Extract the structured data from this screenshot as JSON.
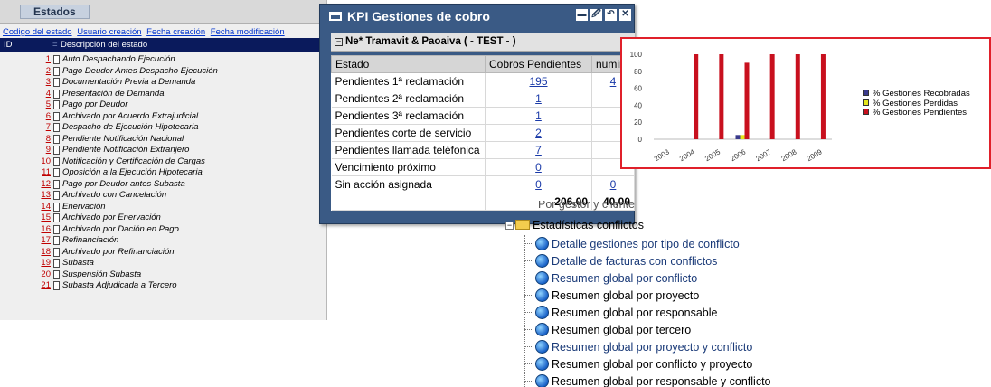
{
  "estados": {
    "title": "Estados",
    "sort_links": [
      "Codigo del estado",
      "Usuario creación",
      "Fecha creación",
      "Fecha modificación"
    ],
    "columns": {
      "id": "ID",
      "sort_marker": "=",
      "description": "Descripción del estado"
    },
    "rows": [
      {
        "id": "1",
        "desc": "Auto Despachando Ejecución"
      },
      {
        "id": "2",
        "desc": "Pago Deudor Antes Despacho Ejecución"
      },
      {
        "id": "3",
        "desc": "Documentación Previa a Demanda"
      },
      {
        "id": "4",
        "desc": "Presentación de Demanda"
      },
      {
        "id": "5",
        "desc": "Pago por Deudor"
      },
      {
        "id": "6",
        "desc": "Archivado por Acuerdo Extrajudicial"
      },
      {
        "id": "7",
        "desc": "Despacho de Ejecución Hipotecaria"
      },
      {
        "id": "8",
        "desc": "Pendiente Notificación Nacional"
      },
      {
        "id": "9",
        "desc": "Pendiente Notificación Extranjero"
      },
      {
        "id": "10",
        "desc": "Notificación y Certificación de Cargas"
      },
      {
        "id": "11",
        "desc": "Oposición a la Ejecución Hipotecaria"
      },
      {
        "id": "12",
        "desc": "Pago por Deudor antes Subasta"
      },
      {
        "id": "13",
        "desc": "Archivado con Cancelación"
      },
      {
        "id": "14",
        "desc": "Enervación"
      },
      {
        "id": "15",
        "desc": "Archivado por Enervación"
      },
      {
        "id": "16",
        "desc": "Archivado por Dación en Pago"
      },
      {
        "id": "17",
        "desc": "Refinanciación"
      },
      {
        "id": "18",
        "desc": "Archivado por Refinanciación"
      },
      {
        "id": "19",
        "desc": "Subasta"
      },
      {
        "id": "20",
        "desc": "Suspensión Subasta"
      },
      {
        "id": "21",
        "desc": "Subasta Adjudicada a Tercero"
      }
    ]
  },
  "kpi": {
    "title": "KPI Gestiones de cobro",
    "controls": [
      "▬",
      "🖉",
      "↶",
      "✕"
    ],
    "subheader_toggle": "−",
    "subheader": "Ne* Tramavit & Paoaiva ( - TEST - )",
    "columns": [
      "Estado",
      "Cobros Pendientes",
      "numin"
    ],
    "rows": [
      {
        "estado": "Pendientes 1ª reclamación",
        "cobros": "195",
        "num": "4"
      },
      {
        "estado": "Pendientes 2ª reclamación",
        "cobros": "1",
        "num": ""
      },
      {
        "estado": "Pendientes 3ª reclamación",
        "cobros": "1",
        "num": ""
      },
      {
        "estado": "Pendientes corte de servicio",
        "cobros": "2",
        "num": ""
      },
      {
        "estado": "Pendientes llamada teléfonica",
        "cobros": "7",
        "num": ""
      },
      {
        "estado": "Vencimiento próximo",
        "cobros": "0",
        "num": ""
      },
      {
        "estado": "Sin acción asignada",
        "cobros": "0",
        "num": "0"
      }
    ],
    "totals": {
      "label": "",
      "cobros": "206,00",
      "num": "40,00"
    }
  },
  "chart_data": {
    "type": "bar",
    "categories": [
      "2003",
      "2004",
      "2005",
      "2006",
      "2007",
      "2008",
      "2009"
    ],
    "ylim": [
      0,
      100
    ],
    "yticks": [
      0,
      20,
      40,
      60,
      80,
      100
    ],
    "grid": false,
    "legend_position": "right",
    "series": [
      {
        "name": "% Gestiones Recobradas",
        "color": "#3a3a8c",
        "values": [
          0,
          0,
          0,
          5,
          0,
          0,
          0
        ]
      },
      {
        "name": "% Gestiones Perdidas",
        "color": "#e6e61a",
        "values": [
          0,
          0,
          0,
          5,
          0,
          0,
          0
        ]
      },
      {
        "name": "% Gestiones Pendientes",
        "color": "#c8101e",
        "values": [
          0,
          100,
          100,
          90,
          100,
          100,
          100
        ]
      }
    ]
  },
  "tree": {
    "fragment": "Por gestor y cliente",
    "expander": "−",
    "folder": "Estadísticas conflictos",
    "items": [
      {
        "label": "Detalle gestiones por tipo de conflicto",
        "style": "link"
      },
      {
        "label": "Detalle de facturas con conflictos",
        "style": "link"
      },
      {
        "label": "Resumen global por conflicto",
        "style": "link"
      },
      {
        "label": "Resumen global por proyecto",
        "style": "plain"
      },
      {
        "label": "Resumen global por responsable",
        "style": "plain"
      },
      {
        "label": "Resumen global por tercero",
        "style": "plain"
      },
      {
        "label": "Resumen global por proyecto y conflicto",
        "style": "link"
      },
      {
        "label": "Resumen global por conflicto y proyecto",
        "style": "plain"
      },
      {
        "label": "Resumen global por responsable y conflicto",
        "style": "plain"
      }
    ]
  }
}
